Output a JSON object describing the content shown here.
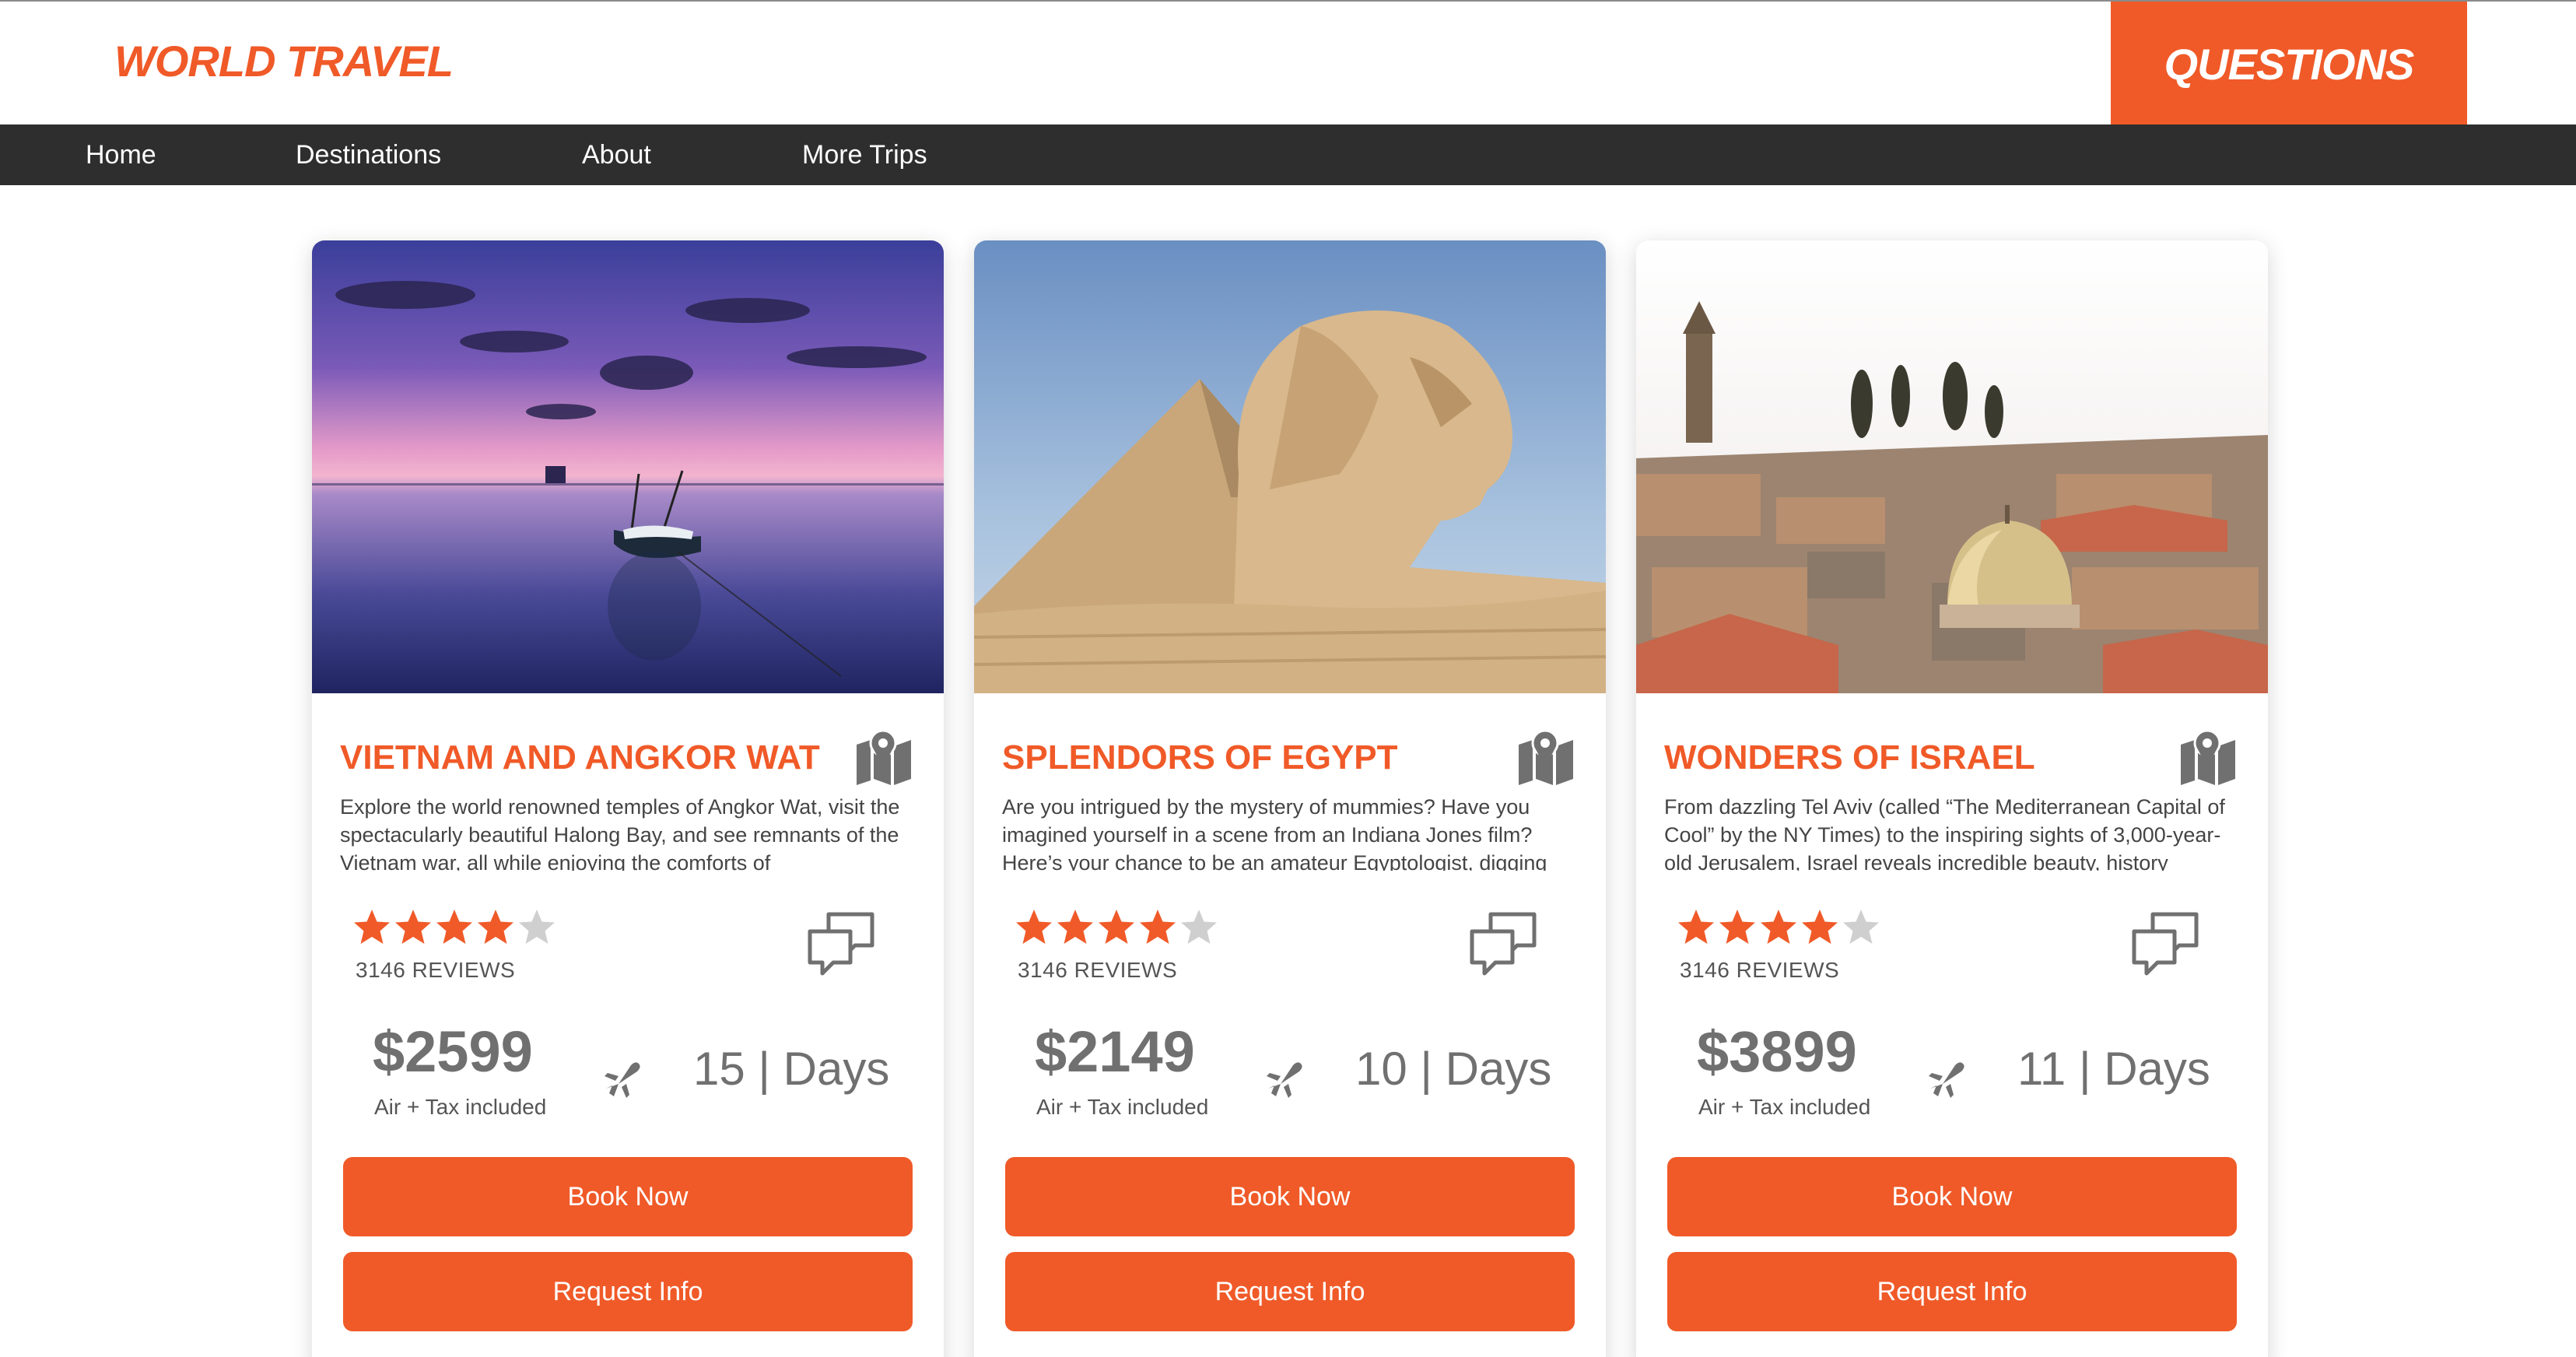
{
  "header": {
    "brand": "WORLD TRAVEL",
    "questions_label": "QUESTIONS"
  },
  "nav": {
    "items": [
      {
        "label": "Home"
      },
      {
        "label": "Destinations"
      },
      {
        "label": "About"
      },
      {
        "label": "More Trips"
      }
    ]
  },
  "colors": {
    "accent": "#f05a28",
    "nav_bg": "#2e2e2e",
    "star_filled": "#f05a28",
    "star_empty": "#cfcfcf",
    "icon_gray": "#707070"
  },
  "trips": [
    {
      "title": "VIETNAM AND ANGKOR WAT",
      "description": "Explore the world renowned temples of Angkor Wat, visit the spectacularly beautiful Halong Bay, and see remnants of the Vietnam war, all while enjoying the comforts of",
      "rating": 4,
      "rating_max": 5,
      "reviews": "3146 REVIEWS",
      "price": "$2599",
      "price_note": "Air + Tax included",
      "days": "15 | Days",
      "book_label": "Book Now",
      "info_label": "Request Info"
    },
    {
      "title": "SPLENDORS OF EGYPT",
      "description": "Are you intrigued by the mystery of mummies? Have you imagined yourself in a scene from an Indiana Jones film? Here’s your chance to be an amateur Egyptologist, digging",
      "rating": 4,
      "rating_max": 5,
      "reviews": "3146 REVIEWS",
      "price": "$2149",
      "price_note": "Air + Tax included",
      "days": "10 | Days",
      "book_label": "Book Now",
      "info_label": "Request Info"
    },
    {
      "title": "WONDERS OF ISRAEL",
      "description": "From dazzling Tel Aviv (called “The Mediterranean Capital of Cool” by the NY Times) to the inspiring sights of 3,000-year-old Jerusalem, Israel reveals incredible beauty, history",
      "rating": 4,
      "rating_max": 5,
      "reviews": "3146 REVIEWS",
      "price": "$3899",
      "price_note": "Air + Tax included",
      "days": "11 | Days",
      "book_label": "Book Now",
      "info_label": "Request Info"
    }
  ]
}
